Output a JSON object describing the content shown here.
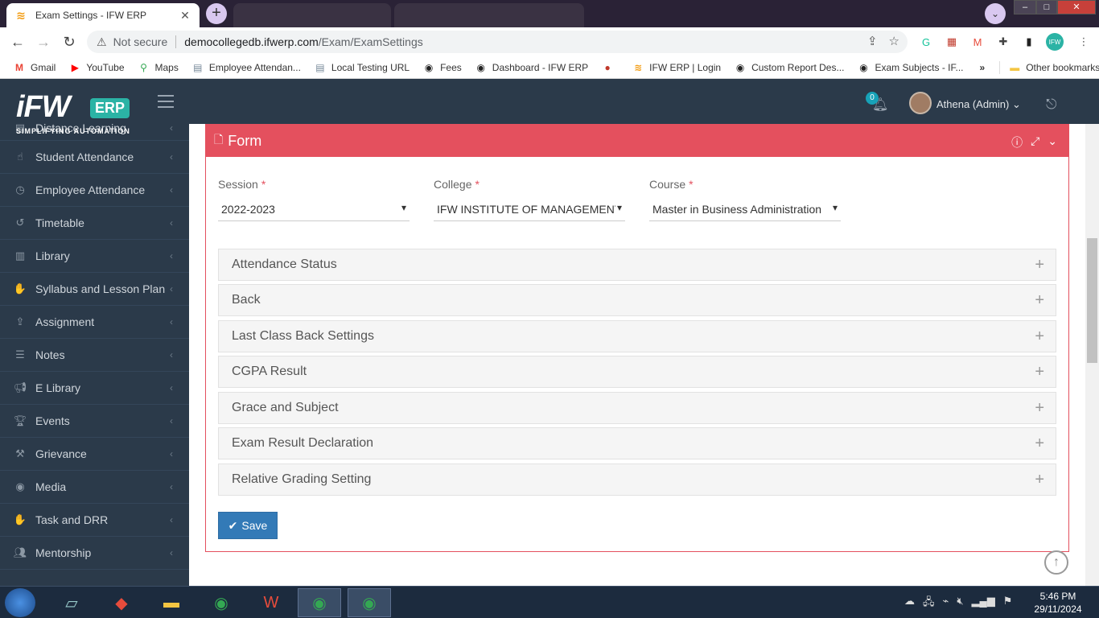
{
  "browser": {
    "active_tab_title": "Exam Settings - IFW ERP",
    "url_security": "Not secure",
    "url_host": "democollegedb.ifwerp.com",
    "url_path": "/Exam/ExamSettings",
    "bookmarks": [
      {
        "label": "Gmail"
      },
      {
        "label": "YouTube"
      },
      {
        "label": "Maps"
      },
      {
        "label": "Employee Attendan..."
      },
      {
        "label": "Local Testing URL"
      },
      {
        "label": "Fees"
      },
      {
        "label": "Dashboard - IFW ERP"
      },
      {
        "label": "IFW ERP | Login"
      },
      {
        "label": "Custom Report Des..."
      },
      {
        "label": "Exam Subjects - IF..."
      }
    ],
    "bookmarks_more": "»",
    "other_bookmarks": "Other bookmarks"
  },
  "header": {
    "logo_ifw": "iFW",
    "logo_erp": "ERP",
    "tagline": "SIMPLIFYING AUTOMATION",
    "notification_count": "0",
    "user_name": "Athena (Admin)"
  },
  "sidebar": {
    "partial_item": "Distance Learning",
    "items": [
      {
        "label": "Student Attendance"
      },
      {
        "label": "Employee Attendance"
      },
      {
        "label": "Timetable"
      },
      {
        "label": "Library"
      },
      {
        "label": "Syllabus and Lesson Plan"
      },
      {
        "label": "Assignment"
      },
      {
        "label": "Notes"
      },
      {
        "label": "E Library"
      },
      {
        "label": "Events"
      },
      {
        "label": "Grievance"
      },
      {
        "label": "Media"
      },
      {
        "label": "Task and DRR"
      },
      {
        "label": "Mentorship"
      }
    ]
  },
  "form": {
    "title": "Form",
    "session_label": "Session",
    "session_value": "2022-2023",
    "college_label": "College",
    "college_value": "IFW INSTITUTE OF MANAGEMENT",
    "course_label": "Course",
    "course_value": "Master in Business Administration",
    "required_mark": "*",
    "sections": [
      {
        "label": "Attendance Status"
      },
      {
        "label": "Back"
      },
      {
        "label": "Last Class Back Settings"
      },
      {
        "label": "CGPA Result"
      },
      {
        "label": "Grace and Subject"
      },
      {
        "label": "Exam Result Declaration"
      },
      {
        "label": "Relative Grading  Setting"
      }
    ],
    "save_label": "Save"
  },
  "taskbar": {
    "time": "5:46 PM",
    "date": "29/11/2024"
  }
}
